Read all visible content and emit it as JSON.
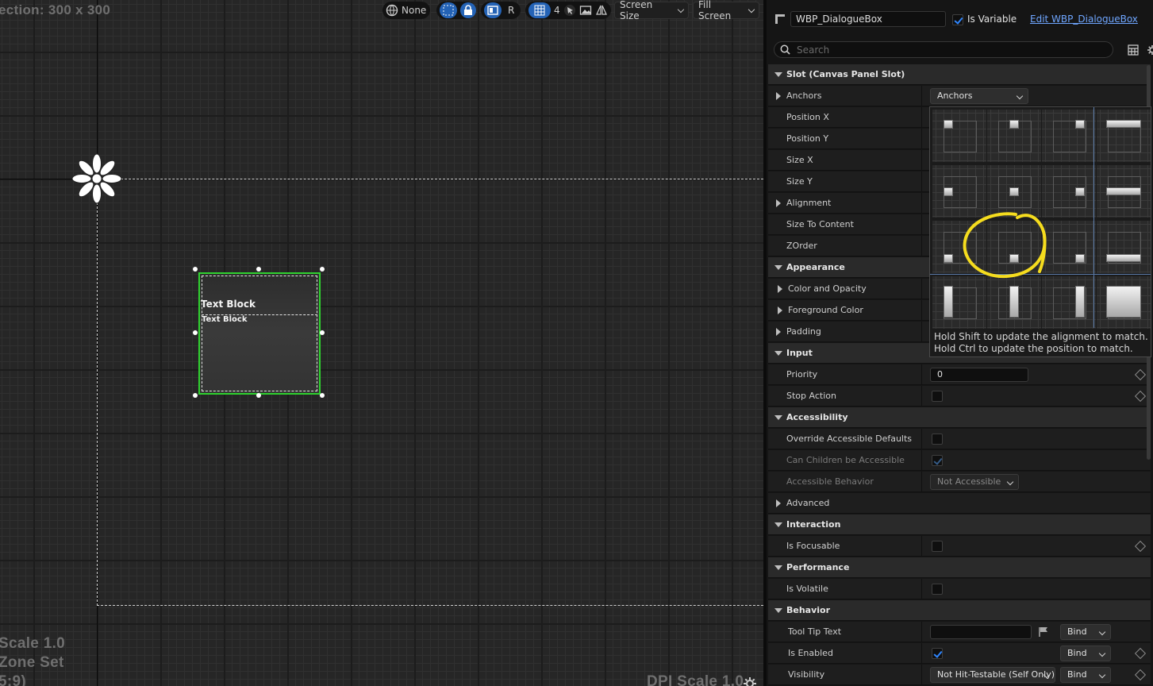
{
  "viewport": {
    "resolution_text": "ection: 300 x 300",
    "scale_text": "Scale 1.0",
    "zone_text": "Zone Set",
    "ratio_text": "5:9)",
    "dpi_text": "DPI Scale 1.0",
    "widget": {
      "text_block_1": "Text Block",
      "text_block_2": "Text Block"
    },
    "toolbar": {
      "localization": "None",
      "r_label": "R",
      "grid_snap": "4",
      "screen_size": "Screen Size",
      "fill_screen": "Fill Screen"
    }
  },
  "details": {
    "widget_name": "WBP_DialogueBox",
    "is_variable_label": "Is Variable",
    "is_variable": true,
    "edit_link": "Edit WBP_DialogueBox",
    "search_placeholder": "Search",
    "sections": {
      "slot": "Slot (Canvas Panel Slot)",
      "appearance": "Appearance",
      "input": "Input",
      "accessibility": "Accessibility",
      "interaction": "Interaction",
      "performance": "Performance",
      "behavior": "Behavior"
    },
    "props": {
      "anchors": "Anchors",
      "anchors_value": "Anchors",
      "position_x": "Position X",
      "position_y": "Position Y",
      "size_x": "Size X",
      "size_y": "Size Y",
      "alignment": "Alignment",
      "size_to_content": "Size To Content",
      "zorder": "ZOrder",
      "color_opacity": "Color and Opacity",
      "foreground_color": "Foreground Color",
      "padding": "Padding",
      "priority": "Priority",
      "priority_value": "0",
      "stop_action": "Stop Action",
      "override_accessible": "Override Accessible Defaults",
      "children_accessible": "Can Children be Accessible",
      "accessible_behavior": "Accessible Behavior",
      "accessible_behavior_value": "Not Accessible",
      "advanced": "Advanced",
      "is_focusable": "Is Focusable",
      "is_volatile": "Is Volatile",
      "tool_tip_text": "Tool Tip Text",
      "is_enabled": "Is Enabled",
      "visibility": "Visibility",
      "visibility_value": "Not Hit-Testable (Self Only)",
      "bind": "Bind"
    },
    "anchor_popup": {
      "hint_1": "Hold Shift to update the alignment to match.",
      "hint_2": "Hold Ctrl to update the position to match."
    }
  },
  "colors": {
    "selection_green": "#2fd12f",
    "accent_blue": "#2463b6",
    "annotation_yellow": "#f5dc1e"
  }
}
